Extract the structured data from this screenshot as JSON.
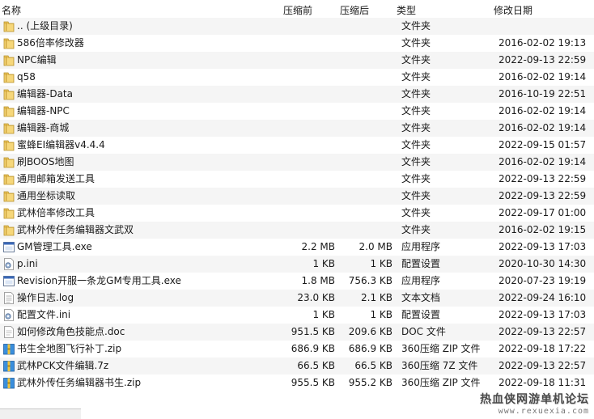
{
  "header": {
    "name": "名称",
    "orig_size": "压缩前",
    "comp_size": "压缩后",
    "type": "类型",
    "date": "修改日期"
  },
  "files": [
    {
      "name": ".. (上级目录)",
      "orig": "",
      "comp": "",
      "type": "文件夹",
      "date": "",
      "icon": "folder-icon"
    },
    {
      "name": "586倍率修改器",
      "orig": "",
      "comp": "",
      "type": "文件夹",
      "date": "2016-02-02 19:13",
      "icon": "folder-icon"
    },
    {
      "name": "NPC编辑",
      "orig": "",
      "comp": "",
      "type": "文件夹",
      "date": "2022-09-13 22:59",
      "icon": "folder-icon"
    },
    {
      "name": "q58",
      "orig": "",
      "comp": "",
      "type": "文件夹",
      "date": "2016-02-02 19:14",
      "icon": "folder-icon"
    },
    {
      "name": "编辑器-Data",
      "orig": "",
      "comp": "",
      "type": "文件夹",
      "date": "2016-10-19 22:51",
      "icon": "folder-icon"
    },
    {
      "name": "编辑器-NPC",
      "orig": "",
      "comp": "",
      "type": "文件夹",
      "date": "2016-02-02 19:14",
      "icon": "folder-icon"
    },
    {
      "name": "编辑器-商城",
      "orig": "",
      "comp": "",
      "type": "文件夹",
      "date": "2016-02-02 19:14",
      "icon": "folder-icon"
    },
    {
      "name": "蜜蜂EI编辑器v4.4.4",
      "orig": "",
      "comp": "",
      "type": "文件夹",
      "date": "2022-09-15 01:57",
      "icon": "folder-icon"
    },
    {
      "name": "刷BOOS地图",
      "orig": "",
      "comp": "",
      "type": "文件夹",
      "date": "2016-02-02 19:14",
      "icon": "folder-icon"
    },
    {
      "name": "通用邮箱发送工具",
      "orig": "",
      "comp": "",
      "type": "文件夹",
      "date": "2022-09-13 22:59",
      "icon": "folder-icon"
    },
    {
      "name": "通用坐标读取",
      "orig": "",
      "comp": "",
      "type": "文件夹",
      "date": "2022-09-13 22:59",
      "icon": "folder-icon"
    },
    {
      "name": "武林倍率修改工具",
      "orig": "",
      "comp": "",
      "type": "文件夹",
      "date": "2022-09-17 01:00",
      "icon": "folder-icon"
    },
    {
      "name": "武林外传任务编辑器文武双",
      "orig": "",
      "comp": "",
      "type": "文件夹",
      "date": "2016-02-02 19:15",
      "icon": "folder-icon"
    },
    {
      "name": "GM管理工具.exe",
      "orig": "2.2 MB",
      "comp": "2.0 MB",
      "type": "应用程序",
      "date": "2022-09-13 17:03",
      "icon": "exe-icon"
    },
    {
      "name": "p.ini",
      "orig": "1 KB",
      "comp": "1 KB",
      "type": "配置设置",
      "date": "2020-10-30 14:30",
      "icon": "ini-icon"
    },
    {
      "name": "Revision开服一条龙GM专用工具.exe",
      "orig": "1.8 MB",
      "comp": "756.3 KB",
      "type": "应用程序",
      "date": "2020-07-23 19:19",
      "icon": "exe-icon"
    },
    {
      "name": "操作日志.log",
      "orig": "23.0 KB",
      "comp": "2.1 KB",
      "type": "文本文档",
      "date": "2022-09-24 16:10",
      "icon": "text-icon"
    },
    {
      "name": "配置文件.ini",
      "orig": "1 KB",
      "comp": "1 KB",
      "type": "配置设置",
      "date": "2022-09-13 17:03",
      "icon": "ini-icon"
    },
    {
      "name": "如何修改角色技能点.doc",
      "orig": "951.5 KB",
      "comp": "209.6 KB",
      "type": "DOC 文件",
      "date": "2022-09-13 22:57",
      "icon": "doc-icon"
    },
    {
      "name": "书生全地图飞行补丁.zip",
      "orig": "686.9 KB",
      "comp": "686.9 KB",
      "type": "360压缩 ZIP 文件",
      "date": "2022-09-18 17:22",
      "icon": "archive-icon"
    },
    {
      "name": "武林PCK文件编辑.7z",
      "orig": "66.5 KB",
      "comp": "66.5 KB",
      "type": "360压缩 7Z 文件",
      "date": "2022-09-13 22:57",
      "icon": "archive-icon"
    },
    {
      "name": "武林外传任务编辑器书生.zip",
      "orig": "955.5 KB",
      "comp": "955.2 KB",
      "type": "360压缩 ZIP 文件",
      "date": "2022-09-18 11:31",
      "icon": "archive-icon"
    }
  ],
  "watermark": {
    "title": "热血侠网游单机论坛",
    "url": "www.rexuexia.com"
  }
}
